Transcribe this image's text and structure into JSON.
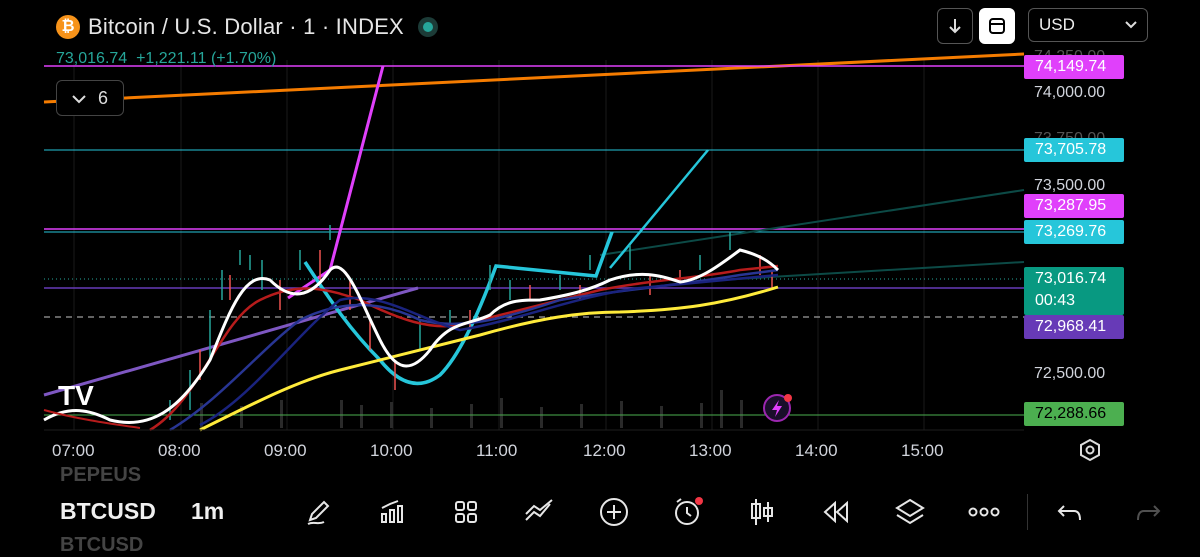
{
  "header": {
    "logo_glyph": "₿",
    "title": "Bitcoin / U.S. Dollar · 1 · INDEX",
    "price": "73,016.74",
    "change": "+1,221.11",
    "change_pct": "(+1.70%)",
    "indicator_count": "6",
    "currency": "USD",
    "status_color": "#26a69a"
  },
  "price_axis": {
    "ticks": [
      "74,000.00",
      "73,500.00",
      "72,500.00"
    ],
    "faded_ticks": [
      "74,250.00",
      "73,750.00"
    ],
    "labels": {
      "orange_line": "74,149.74",
      "cyan_line": "73,705.78",
      "pink_line": "73,287.95",
      "cyan_line_2": "73,269.76",
      "last_price": "73,016.74",
      "countdown": "00:43",
      "purple_line": "72,968.41",
      "green_line": "72,288.66"
    },
    "colors": {
      "orange": "#f57c00",
      "pink": "#e040fb",
      "cyan": "#26c6da",
      "teal": "#089981",
      "purple": "#673ab7",
      "green": "#4caf50"
    }
  },
  "time_axis": [
    "07:00",
    "08:00",
    "09:00",
    "10:00",
    "11:00",
    "12:00",
    "13:00",
    "14:00",
    "15:00"
  ],
  "watermark": "TV",
  "toolbar": {
    "symbol": "BTCUSD",
    "interval": "1m",
    "prev_symbol": "PEPEUS",
    "next_symbol": "BTCUSD",
    "icons": [
      "pen-icon",
      "chart-bars-icon",
      "grid-icon",
      "trend-icon",
      "add-icon",
      "alarm-icon",
      "candles-icon",
      "rewind-icon",
      "layers-icon",
      "more-icon",
      "undo-icon"
    ]
  }
}
